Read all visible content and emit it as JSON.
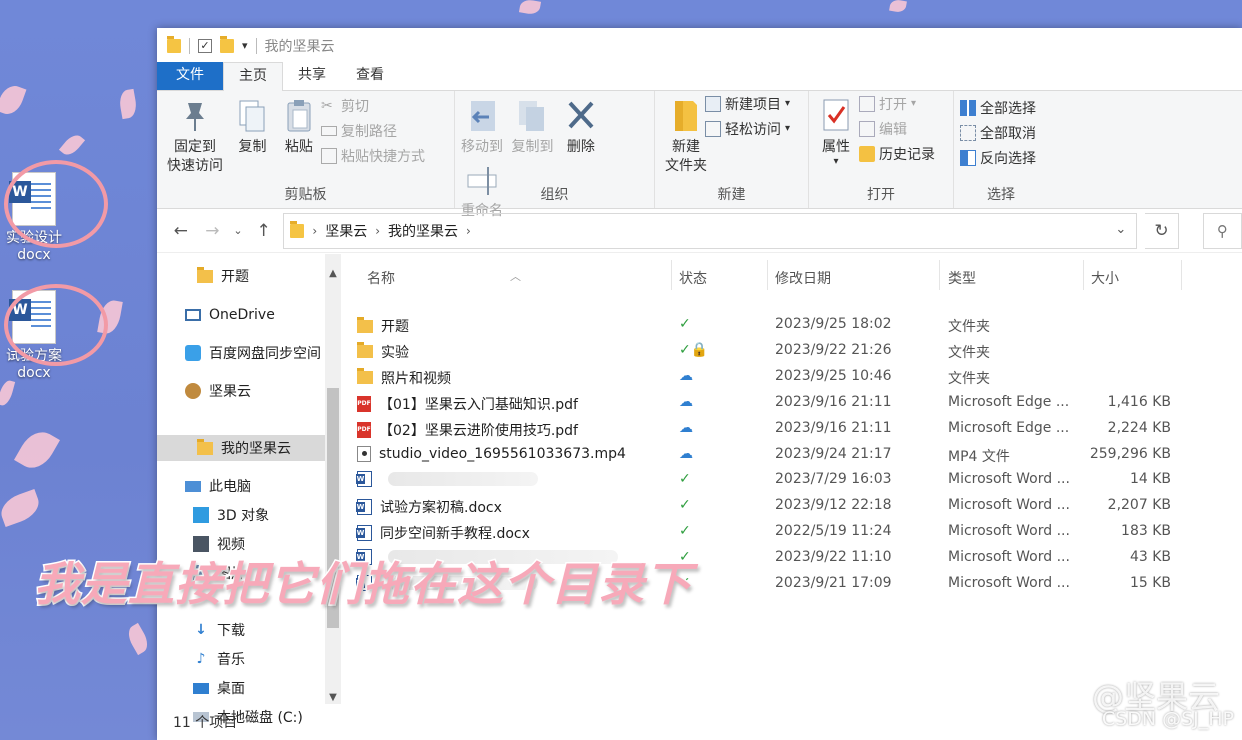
{
  "desktop": {
    "icons": [
      {
        "label_top": "实验设计",
        "label_bottom": "docx"
      },
      {
        "label_top": "试验方案",
        "label_bottom": "docx"
      }
    ]
  },
  "window": {
    "title": "我的坚果云",
    "qa_dropdown": "▾"
  },
  "ribbon_tabs": [
    "文件",
    "主页",
    "共享",
    "查看"
  ],
  "ribbon": {
    "clipboard": {
      "pin_label_1": "固定到",
      "pin_label_2": "快速访问",
      "copy": "复制",
      "paste": "粘贴",
      "cut": "剪切",
      "copy_path": "复制路径",
      "paste_shortcut": "粘贴快捷方式",
      "label": "剪贴板"
    },
    "organize": {
      "move_to": "移动到",
      "copy_to": "复制到",
      "delete": "删除",
      "rename": "重命名",
      "label": "组织"
    },
    "new": {
      "new_folder_1": "新建",
      "new_folder_2": "文件夹",
      "new_item": "新建项目",
      "easy_access": "轻松访问",
      "label": "新建"
    },
    "open": {
      "properties": "属性",
      "open": "打开",
      "edit": "编辑",
      "history": "历史记录",
      "label": "打开"
    },
    "select": {
      "select_all": "全部选择",
      "select_none": "全部取消",
      "invert": "反向选择",
      "label": "选择"
    }
  },
  "address": {
    "crumbs": [
      "坚果云",
      "我的坚果云"
    ]
  },
  "nav_pane": {
    "items": [
      {
        "label": "开题"
      },
      {
        "label": "OneDrive"
      },
      {
        "label": "百度网盘同步空间"
      },
      {
        "label": "坚果云"
      },
      {
        "label": "我的坚果云"
      },
      {
        "label": "此电脑"
      },
      {
        "label": "3D 对象"
      },
      {
        "label": "视频"
      },
      {
        "label": "图片"
      },
      {
        "label": "下载"
      },
      {
        "label": "音乐"
      },
      {
        "label": "桌面"
      },
      {
        "label": "本地磁盘 (C:)"
      }
    ]
  },
  "columns": {
    "name": "名称",
    "status": "状态",
    "date": "修改日期",
    "type": "类型",
    "size": "大小"
  },
  "files": [
    {
      "name": "开题",
      "status": "✓",
      "date": "2023/9/25 18:02",
      "type": "文件夹",
      "size": "",
      "icon": "folder"
    },
    {
      "name": "实验",
      "status": "✓🔒",
      "date": "2023/9/22 21:26",
      "type": "文件夹",
      "size": "",
      "icon": "folder"
    },
    {
      "name": "照片和视频",
      "status": "☁",
      "date": "2023/9/25 10:46",
      "type": "文件夹",
      "size": "",
      "icon": "folder"
    },
    {
      "name": "【01】坚果云入门基础知识.pdf",
      "status": "☁",
      "date": "2023/9/16 21:11",
      "type": "Microsoft Edge ...",
      "size": "1,416 KB",
      "icon": "pdf"
    },
    {
      "name": "【02】坚果云进阶使用技巧.pdf",
      "status": "☁",
      "date": "2023/9/16 21:11",
      "type": "Microsoft Edge ...",
      "size": "2,224 KB",
      "icon": "pdf"
    },
    {
      "name": "studio_video_1695561033673.mp4",
      "status": "☁",
      "date": "2023/9/24 21:17",
      "type": "MP4 文件",
      "size": "259,296 KB",
      "icon": "mp4"
    },
    {
      "name": "",
      "status": "✓",
      "date": "2023/7/29 16:03",
      "type": "Microsoft Word ...",
      "size": "14 KB",
      "icon": "word"
    },
    {
      "name": "试验方案初稿.docx",
      "status": "✓",
      "date": "2023/9/12 22:18",
      "type": "Microsoft Word ...",
      "size": "2,207 KB",
      "icon": "word"
    },
    {
      "name": "同步空间新手教程.docx",
      "status": "✓",
      "date": "2022/5/19 11:24",
      "type": "Microsoft Word ...",
      "size": "183 KB",
      "icon": "word"
    },
    {
      "name": "",
      "status": "✓",
      "date": "2023/9/22 11:10",
      "type": "Microsoft Word ...",
      "size": "43 KB",
      "icon": "word"
    },
    {
      "name": "",
      "status": "✓",
      "date": "2023/9/21 17:09",
      "type": "Microsoft Word ...",
      "size": "15 KB",
      "icon": "word"
    }
  ],
  "statusbar": {
    "count": "11 个项目"
  },
  "overlay": {
    "subtitle": "我是直接把它们拖在这个目录下",
    "watermark": "@坚果云",
    "csdn": "CSDN @SJ_HP"
  },
  "colors": {
    "accent": "#1e6fc8",
    "synced": "#2e9e3e",
    "cloud": "#2f7fd0",
    "subtitle": "#f7a9b9"
  }
}
